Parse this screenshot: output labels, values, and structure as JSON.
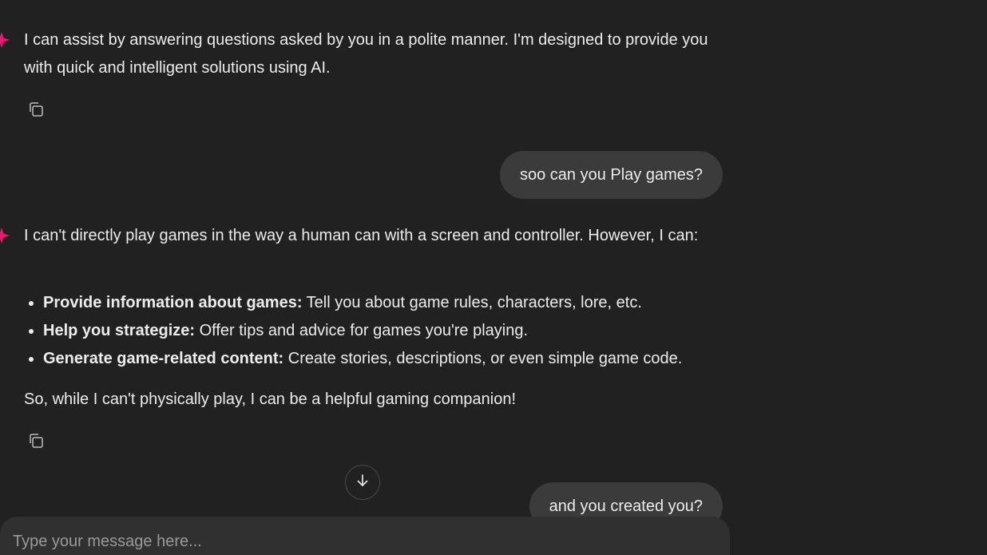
{
  "messages": {
    "assistant_1": {
      "text": "I can assist by answering questions asked by you in a polite manner. I'm designed to provide you with quick and intelligent solutions using AI."
    },
    "user_1": {
      "text": "soo can you Play games?"
    },
    "assistant_2": {
      "intro": "I can't directly play games in the way a human can with a screen and controller. However, I can:",
      "bullets": [
        {
          "title": "Provide information about games:",
          "text": " Tell you about game rules, characters, lore, etc."
        },
        {
          "title": "Help you strategize:",
          "text": " Offer tips and advice for games you're playing."
        },
        {
          "title": "Generate game-related content:",
          "text": " Create stories, descriptions, or even simple game code."
        }
      ],
      "outro": "So, while I can't physically play, I can be a helpful gaming companion!"
    },
    "user_2": {
      "text": "and you created you?"
    }
  },
  "composer": {
    "placeholder": "Type your message here..."
  },
  "icons": {
    "assistant": "sparkle-icon",
    "copy": "copy-icon",
    "scroll": "arrow-down-icon"
  },
  "colors": {
    "background": "#212121",
    "user_bubble": "#3b3b3b",
    "assistant_accent": "#e8186d",
    "composer": "#303030"
  }
}
